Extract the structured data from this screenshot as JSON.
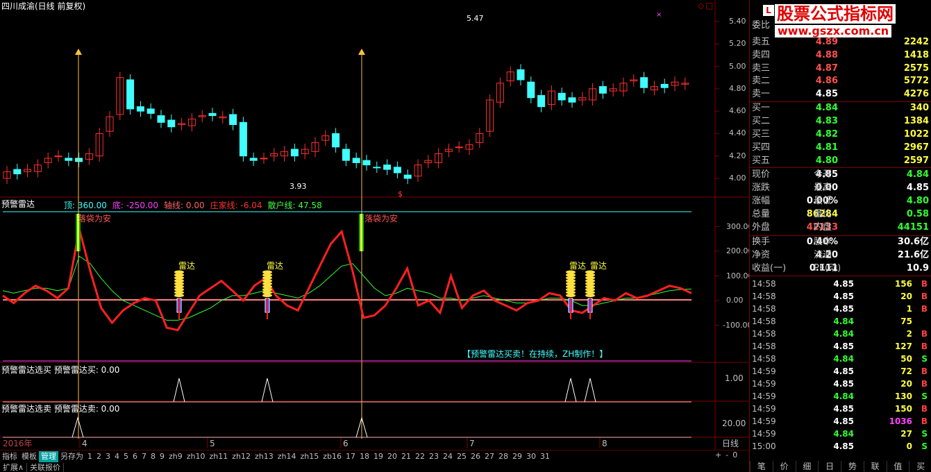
{
  "window": {
    "stock_title": "四川成渝(日线 前复权)",
    "period_label": "日线",
    "year_label": "2016年",
    "months": [
      "4",
      "5",
      "6",
      "7",
      "8"
    ]
  },
  "price_axis": {
    "ticks": [
      "5.40",
      "5.20",
      "5.00",
      "4.80",
      "4.60",
      "4.40",
      "4.20",
      "4.00"
    ],
    "high_marker": "5.47",
    "low_marker": "3.93"
  },
  "indicator": {
    "name": "预警雷达",
    "legend": [
      {
        "label": "顶: 360.00",
        "color": "#40ffff"
      },
      {
        "label": "底: -250.00",
        "color": "#ff40ff"
      },
      {
        "label": "轴线: 0.00",
        "color": "#ff6060"
      },
      {
        "label": "庄家线: -6.04",
        "color": "#ff3030"
      },
      {
        "label": "散户线: 47.58",
        "color": "#40ff40"
      }
    ],
    "axis_ticks": [
      "300.00",
      "200.00",
      "100.00",
      "0.00",
      "-100.00"
    ],
    "signal_labels": [
      "落袋为安",
      "落袋为安"
    ],
    "radar_labels": [
      "雷达",
      "雷达",
      "雷达",
      "雷达"
    ],
    "footer_text": "【预警雷达买卖！在持续，ZH制作！】"
  },
  "sub_panels": [
    {
      "title": "预警雷达选买  预警雷达买: 0.00",
      "tick": "1.00"
    },
    {
      "title": "预警雷达选卖  预警雷达卖: 0.00",
      "tick": "20.00"
    }
  ],
  "bottom_tabs": [
    "指标",
    "模板",
    "管理",
    "另存为",
    "1",
    "2",
    "3",
    "4",
    "5",
    "6",
    "7",
    "8",
    "9",
    "zh9",
    "zh10",
    "zh11",
    "zh12",
    "zh13",
    "zh14",
    "zh15",
    "zb16",
    "17",
    "18",
    "19",
    "20",
    "21",
    "22",
    "23",
    "24",
    "25",
    "26",
    "27",
    "28",
    "29",
    "30",
    "31"
  ],
  "bottom_bar": [
    "扩展∧",
    "关联报价"
  ],
  "nav_buttons": [
    "+",
    "-",
    "0"
  ],
  "watermark": {
    "line1": "股票公式指标网",
    "line2": "www.gszx.com.cn"
  },
  "order_book": {
    "header": "委比",
    "asks": [
      {
        "label": "卖五",
        "price": "4.89",
        "vol": "2242"
      },
      {
        "label": "卖四",
        "price": "4.88",
        "vol": "1418"
      },
      {
        "label": "卖三",
        "price": "4.87",
        "vol": "2575"
      },
      {
        "label": "卖二",
        "price": "4.86",
        "vol": "5772"
      },
      {
        "label": "卖一",
        "price": "4.85",
        "vol": "4276"
      }
    ],
    "bids": [
      {
        "label": "买一",
        "price": "4.84",
        "vol": "340"
      },
      {
        "label": "买二",
        "price": "4.83",
        "vol": "1384"
      },
      {
        "label": "买三",
        "price": "4.82",
        "vol": "1022"
      },
      {
        "label": "买四",
        "price": "4.81",
        "vol": "2967"
      },
      {
        "label": "买五",
        "price": "4.80",
        "vol": "2597"
      }
    ]
  },
  "quote": [
    {
      "l1": "现价",
      "v1": "4.85",
      "l2": "今开",
      "v2": "4.84"
    },
    {
      "l1": "涨跌",
      "v1": "0.00",
      "l2": "最高",
      "v2": "4.85"
    },
    {
      "l1": "涨幅",
      "v1": "0.00%",
      "l2": "最低",
      "v2": "4.80"
    },
    {
      "l1": "总量",
      "v1": "86284",
      "l2": "量比",
      "v2": "0.58"
    },
    {
      "l1": "外盘",
      "v1": "42133",
      "l2": "内盘",
      "v2": "44151"
    }
  ],
  "fundamentals": [
    {
      "l1": "换手",
      "v1": "0.40%",
      "l2": "股本",
      "v2": "30.6亿"
    },
    {
      "l1": "净资",
      "v1": "4.20",
      "l2": "流通",
      "v2": "21.6亿"
    },
    {
      "l1": "收益(一)",
      "v1": "0.111",
      "l2": "PE(动)",
      "v2": "10.9"
    }
  ],
  "ticks": [
    {
      "time": "14:58",
      "price": "4.85",
      "vol": "156",
      "side": "B"
    },
    {
      "time": "14:58",
      "price": "4.85",
      "vol": "20",
      "side": "B"
    },
    {
      "time": "14:58",
      "price": "4.85",
      "vol": "1",
      "side": "B"
    },
    {
      "time": "14:58",
      "price": "4.84",
      "vol": "75",
      "side": ""
    },
    {
      "time": "14:58",
      "price": "4.84",
      "vol": "2",
      "side": "B"
    },
    {
      "time": "14:58",
      "price": "4.85",
      "vol": "127",
      "side": "B"
    },
    {
      "time": "14:58",
      "price": "4.84",
      "vol": "50",
      "side": "S"
    },
    {
      "time": "14:59",
      "price": "4.85",
      "vol": "72",
      "side": "B"
    },
    {
      "time": "14:59",
      "price": "4.85",
      "vol": "20",
      "side": "B"
    },
    {
      "time": "14:59",
      "price": "4.84",
      "vol": "130",
      "side": "S"
    },
    {
      "time": "14:59",
      "price": "4.85",
      "vol": "150",
      "side": "B"
    },
    {
      "time": "14:59",
      "price": "4.85",
      "vol": "1036",
      "side": "B"
    },
    {
      "time": "14:59",
      "price": "4.84",
      "vol": "27",
      "side": "S"
    },
    {
      "time": "15:00",
      "price": "4.85",
      "vol": "0",
      "side": "S"
    }
  ],
  "right_tabs": [
    "笔",
    "价",
    "细",
    "日",
    "势",
    "联",
    "值",
    "买"
  ],
  "colors": {
    "up": "#ff3030",
    "down": "#40ffff",
    "grid": "#800000",
    "fast": "#ff2020",
    "slow": "#30ff30"
  }
}
